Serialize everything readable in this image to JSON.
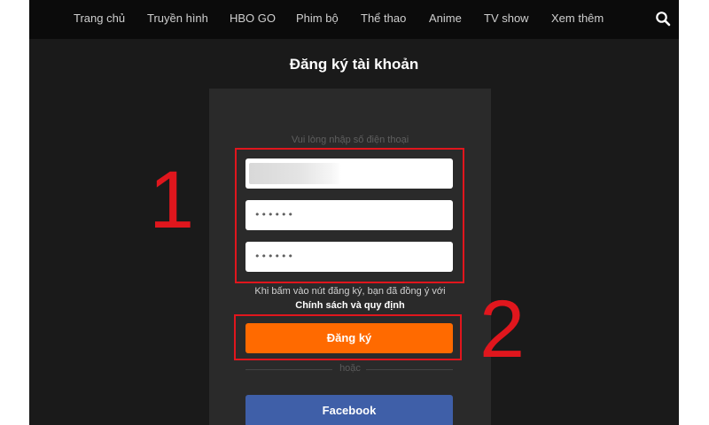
{
  "nav": {
    "items": [
      {
        "label": "Trang chủ"
      },
      {
        "label": "Truyền hình"
      },
      {
        "label": "HBO GO"
      },
      {
        "label": "Phim bộ"
      },
      {
        "label": "Thể thao"
      },
      {
        "label": "Anime"
      },
      {
        "label": "TV show"
      },
      {
        "label": "Xem thêm"
      }
    ],
    "search_icon": "search-icon"
  },
  "page": {
    "title": "Đăng ký tài khoản"
  },
  "form": {
    "phone_hint": "Vui lòng nhập số điện thoại",
    "phone_value": "",
    "password_mask": "••••••",
    "confirm_password_mask": "••••••",
    "terms_text": "Khi bấm vào nút đăng ký, bạn đã đồng ý với",
    "policy_link": "Chính sách và quy định",
    "register_label": "Đăng ký",
    "or_label": "hoặc",
    "facebook_label": "Facebook"
  },
  "annotations": {
    "box1_number": "1",
    "box2_number": "2"
  },
  "colors": {
    "accent_orange": "#ff6a00",
    "facebook_blue": "#3f5fa8",
    "annotation_red": "#e0161d",
    "background": "#1a1a1a"
  }
}
